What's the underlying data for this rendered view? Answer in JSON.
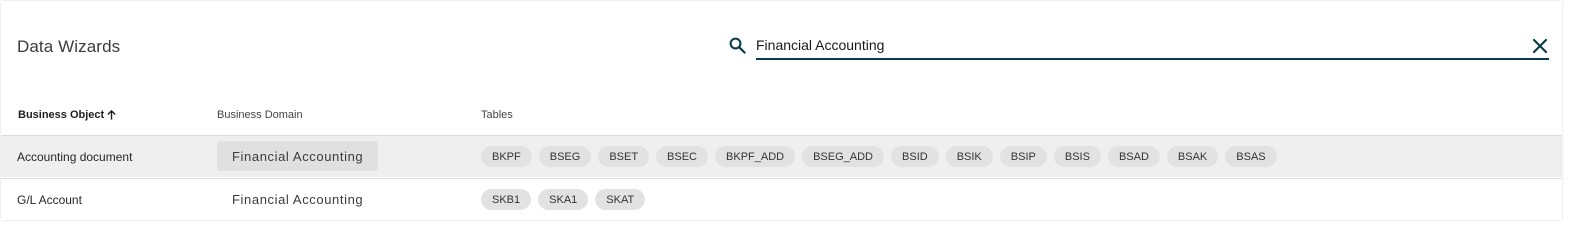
{
  "header": {
    "title": "Data Wizards"
  },
  "search": {
    "value": "Financial Accounting",
    "icon": "search-icon",
    "clear_icon": "close-icon"
  },
  "columns": [
    {
      "label": "Business Object",
      "sorted": "ascending"
    },
    {
      "label": "Business Domain"
    },
    {
      "label": "Tables"
    }
  ],
  "rows": [
    {
      "object": "Accounting document",
      "domain": "Financial Accounting",
      "selected": true,
      "tables": [
        "BKPF",
        "BSEG",
        "BSET",
        "BSEC",
        "BKPF_ADD",
        "BSEG_ADD",
        "BSID",
        "BSIK",
        "BSIP",
        "BSIS",
        "BSAD",
        "BSAK",
        "BSAS"
      ]
    },
    {
      "object": "G/L Account",
      "domain": "Financial Accounting",
      "selected": false,
      "tables": [
        "SKB1",
        "SKA1",
        "SKAT"
      ]
    }
  ],
  "colors": {
    "accent": "#0b3b4d",
    "row_selected": "#efefef",
    "tag_bg": "#e2e2e2"
  }
}
